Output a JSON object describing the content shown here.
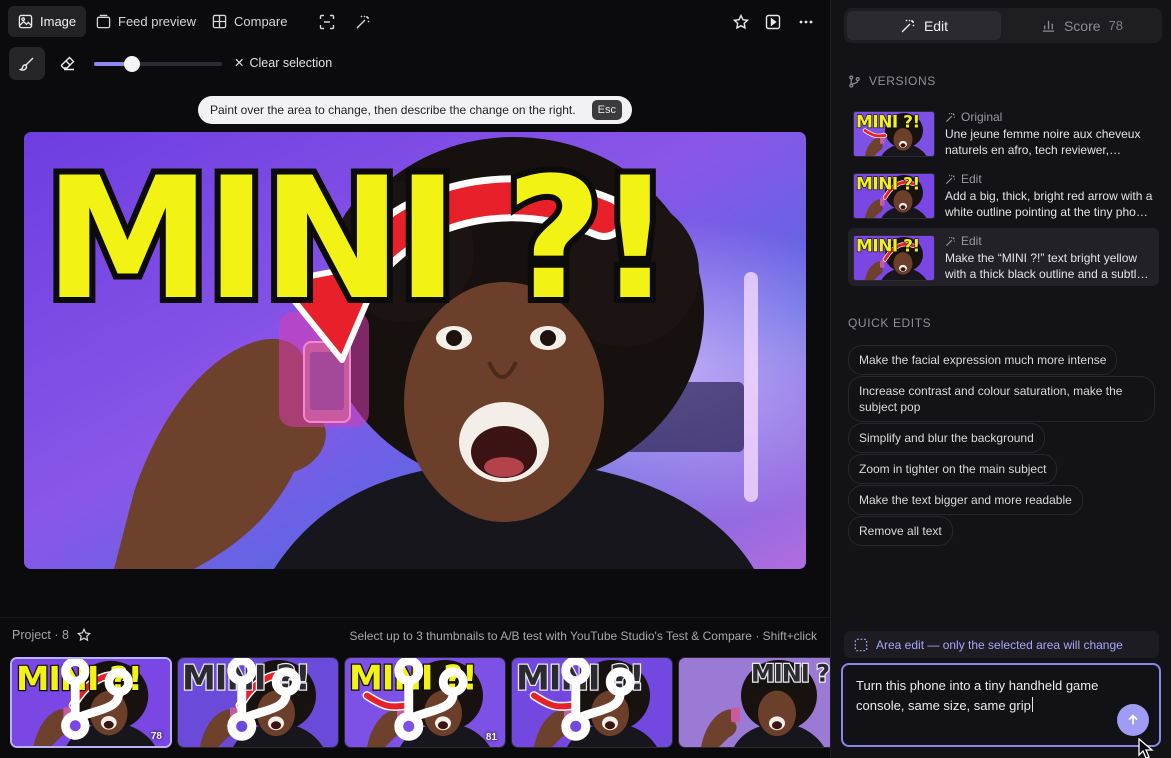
{
  "toolbar": {
    "image_label": "Image",
    "feed_preview_label": "Feed preview",
    "compare_label": "Compare"
  },
  "tools": {
    "clear_selection_label": "Clear selection",
    "brush_size_fraction": 0.3
  },
  "hint": {
    "text": "Paint over the area to change, then describe the change on the right.",
    "key": "Esc"
  },
  "canvas": {
    "headline": "MINI ?!"
  },
  "project": {
    "label": "Project · 8",
    "hint": "Select up to 3 thumbnails to A/B test with YouTube Studio's Test & Compare · Shift+click",
    "thumbnails": [
      {
        "headline": "MINI ?!",
        "score": "78",
        "selected": true
      },
      {
        "headline": "MINI ?!",
        "score": "",
        "selected": false
      },
      {
        "headline": "MINI ?!",
        "score": "81",
        "selected": false
      },
      {
        "headline": "MINI ?!",
        "score": "",
        "selected": false
      },
      {
        "headline": "MINI ?!",
        "score": "",
        "selected": false
      }
    ]
  },
  "panel": {
    "edit_tab": "Edit",
    "score_tab": "Score",
    "score_value": "78",
    "versions_title": "VERSIONS",
    "versions": [
      {
        "tag": "Original",
        "desc": "Une jeune femme noire aux cheveux naturels en afro, tech reviewer, regardant la caméra avec une expression choquée"
      },
      {
        "tag": "Edit",
        "desc": "Add a big, thick, bright red arrow with a white outline pointing at the tiny phone in her hand"
      },
      {
        "tag": "Edit",
        "desc": "Make the “MINI ?!” text bright yellow with a thick black outline and a subtle glow"
      }
    ],
    "quick_edits_title": "QUICK EDITS",
    "quick_edits": [
      "Make the facial expression much more intense",
      "Increase contrast and colour saturation, make the subject pop",
      "Simplify and blur the background",
      "Zoom in tighter on the main subject",
      "Make the text bigger and more readable",
      "Remove all text"
    ],
    "area_note": "Area edit — only the selected area will change",
    "prompt_text": "Turn this phone into a tiny handheld game console, same size, same grip"
  },
  "colors": {
    "accent": "#9f9cf5",
    "headline_yellow": "#f2f215",
    "arrow_red": "#e8202a"
  }
}
